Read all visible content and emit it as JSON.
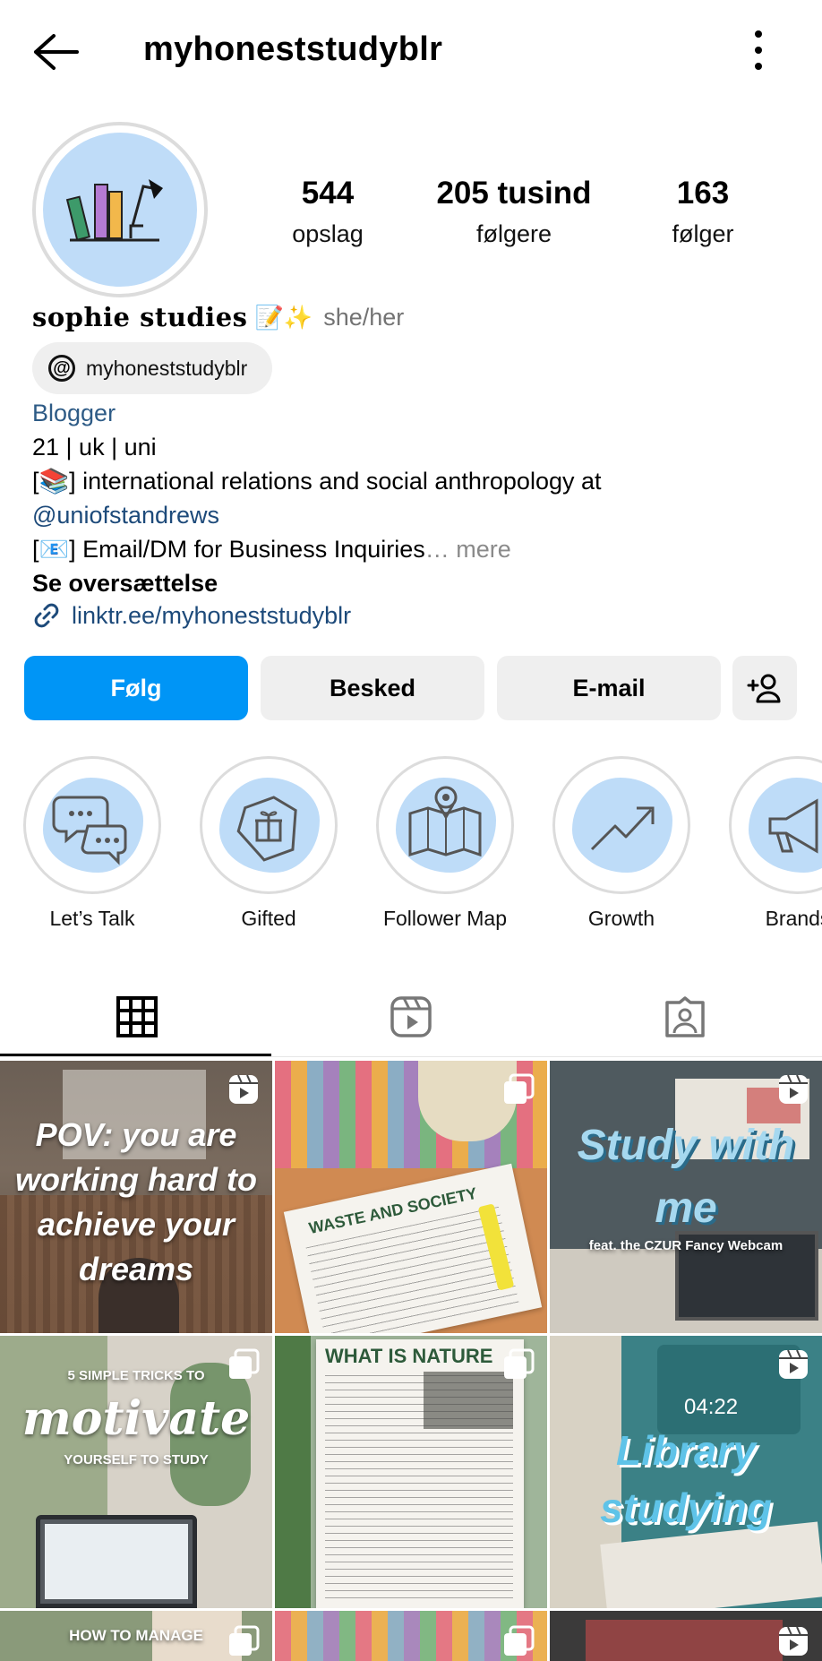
{
  "topbar": {
    "username": "myhoneststudyblr"
  },
  "stats": {
    "posts_count": "544",
    "posts_label": "opslag",
    "followers_count": "205 tusind",
    "followers_label": "følgere",
    "following_count": "163",
    "following_label": "følger"
  },
  "profile": {
    "display_name": "sophie studies",
    "name_emoji": "📝✨",
    "pronouns": "she/her",
    "threads_handle": "myhoneststudyblr",
    "category": "Blogger",
    "bio_line1": "21 | uk | uni",
    "bio_line2": "[📚] international relations and social anthropology at",
    "bio_line3": "@uniofstandrews",
    "bio_line4": "[📧] Email/DM for Business Inquiries",
    "bio_more": "… mere",
    "translate_label": "Se oversættelse",
    "link": "linktr.ee/myhoneststudyblr"
  },
  "actions": {
    "follow": "Følg",
    "message": "Besked",
    "email": "E-mail"
  },
  "highlights": [
    {
      "label": "Let’s Talk",
      "icon": "chat-bubbles-icon"
    },
    {
      "label": "Gifted",
      "icon": "gift-tag-icon"
    },
    {
      "label": "Follower Map",
      "icon": "map-pin-icon"
    },
    {
      "label": "Growth",
      "icon": "trend-up-icon"
    },
    {
      "label": "Brands",
      "icon": "megaphone-icon"
    }
  ],
  "tabs": [
    {
      "icon": "grid-icon",
      "selected": true
    },
    {
      "icon": "reels-icon",
      "selected": false
    },
    {
      "icon": "tagged-icon",
      "selected": false
    }
  ],
  "grid": {
    "tile1_text": "POV: you are working hard to achieve your dreams",
    "tile2_text": "WASTE AND SOCIETY",
    "tile3_text": "Study with me",
    "tile3_sub": "feat. the CZUR Fancy Webcam",
    "tile4_text_top": "5 SIMPLE TRICKS TO",
    "tile4_text_main": "motivate",
    "tile4_text_bottom": "YOURSELF TO STUDY",
    "tile5_text": "WHAT IS NATURE",
    "tile6_text": "Library studying",
    "tile6_clock": "04:22",
    "tile7_text": "HOW TO MANAGE"
  },
  "colors": {
    "primary_blue": "#0095f6",
    "link_blue": "#1d4a7a",
    "chip_grey": "#efefef",
    "highlight_blue": "#bedcf8"
  }
}
